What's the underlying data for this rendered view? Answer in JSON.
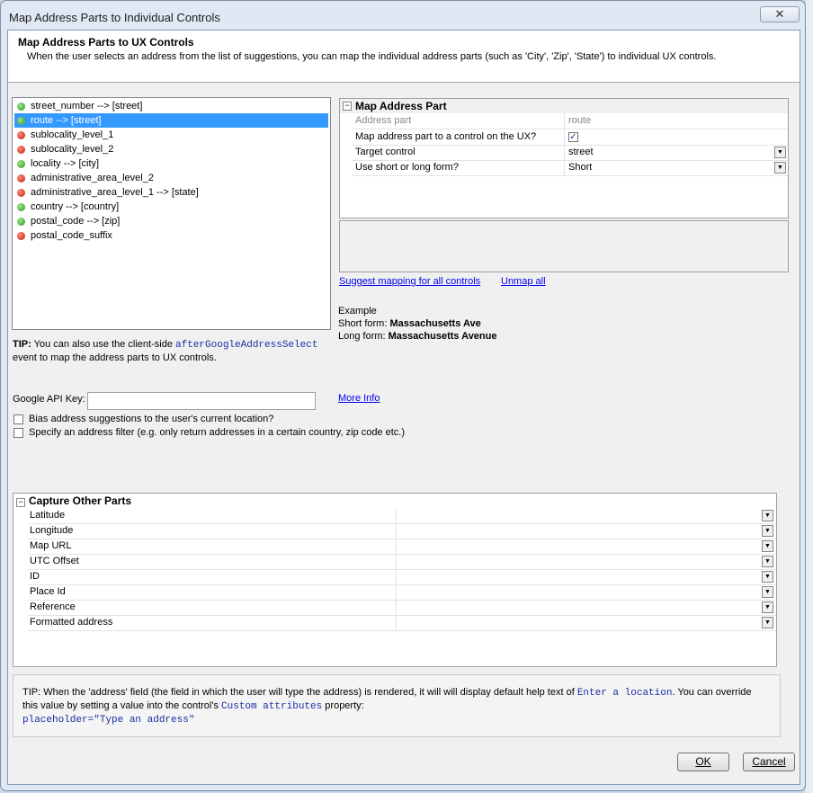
{
  "window": {
    "title": "Map Address Parts to Individual Controls",
    "close_glyph": "✕"
  },
  "header": {
    "title": "Map Address Parts to UX Controls",
    "description": "When the user selects an address from the list of suggestions, you can map the individual address parts (such as 'City', 'Zip', 'State') to individual UX controls."
  },
  "address_parts": [
    {
      "label": "street_number --> [street]",
      "status": "green"
    },
    {
      "label": "route --> [street]",
      "status": "green",
      "selected": true
    },
    {
      "label": "sublocality_level_1",
      "status": "red"
    },
    {
      "label": "sublocality_level_2",
      "status": "red"
    },
    {
      "label": "locality --> [city]",
      "status": "green"
    },
    {
      "label": "administrative_area_level_2",
      "status": "red"
    },
    {
      "label": "administrative_area_level_1 --> [state]",
      "status": "red"
    },
    {
      "label": "country --> [country]",
      "status": "green"
    },
    {
      "label": "postal_code --> [zip]",
      "status": "green"
    },
    {
      "label": "postal_code_suffix",
      "status": "red"
    }
  ],
  "tip1": {
    "bold": "TIP:",
    "pre": " You can also use the client-side ",
    "code": "afterGoogleAddressSelect",
    "post": " event to map the address parts to UX controls."
  },
  "map_part": {
    "heading": "Map Address Part",
    "rows": {
      "address_part": {
        "key": "Address part",
        "value": "route"
      },
      "map_to_control": {
        "key": "Map address part to a control on the UX?",
        "checked": true,
        "check_glyph": "✓"
      },
      "target_control": {
        "key": "Target control",
        "value": "street"
      },
      "form": {
        "key": "Use short or long form?",
        "value": "Short"
      }
    }
  },
  "links": {
    "suggest": "Suggest mapping for all controls",
    "unmap": "Unmap all",
    "more_info": "More Info"
  },
  "example": {
    "heading": "Example",
    "short_label": "Short form: ",
    "short_value": "Massachusetts Ave",
    "long_label": "Long form: ",
    "long_value": "Massachusetts Avenue"
  },
  "api_key": {
    "label": "Google API Key:",
    "value": ""
  },
  "options": {
    "bias": {
      "label": "Bias address suggestions to the user's current location?",
      "checked": false
    },
    "filter": {
      "label": "Specify an address filter (e.g. only return addresses in a certain country, zip code etc.)",
      "checked": false
    }
  },
  "capture": {
    "heading": "Capture Other Parts",
    "rows": [
      "Latitude",
      "Longitude",
      "Map URL",
      "UTC Offset",
      "ID",
      "Place Id",
      "Reference",
      "Formatted address"
    ]
  },
  "tip2": {
    "line1_pre": "TIP: When the 'address' field (the field in which the user will type the address) is rendered, it will will display default help text of ",
    "line1_code": "Enter a location",
    "line1_post": ". You can override this value by setting a value into the control's ",
    "line2_code": "Custom attributes",
    "line2_post": " property:",
    "line3_code": "placeholder=\"Type an address\""
  },
  "buttons": {
    "ok": "OK",
    "cancel": "Cancel"
  },
  "colors": {
    "selected": "#3399ff",
    "link": "#0000ee",
    "code": "#1b2fa0",
    "green": "#2a9a1d",
    "red": "#c5200d"
  }
}
